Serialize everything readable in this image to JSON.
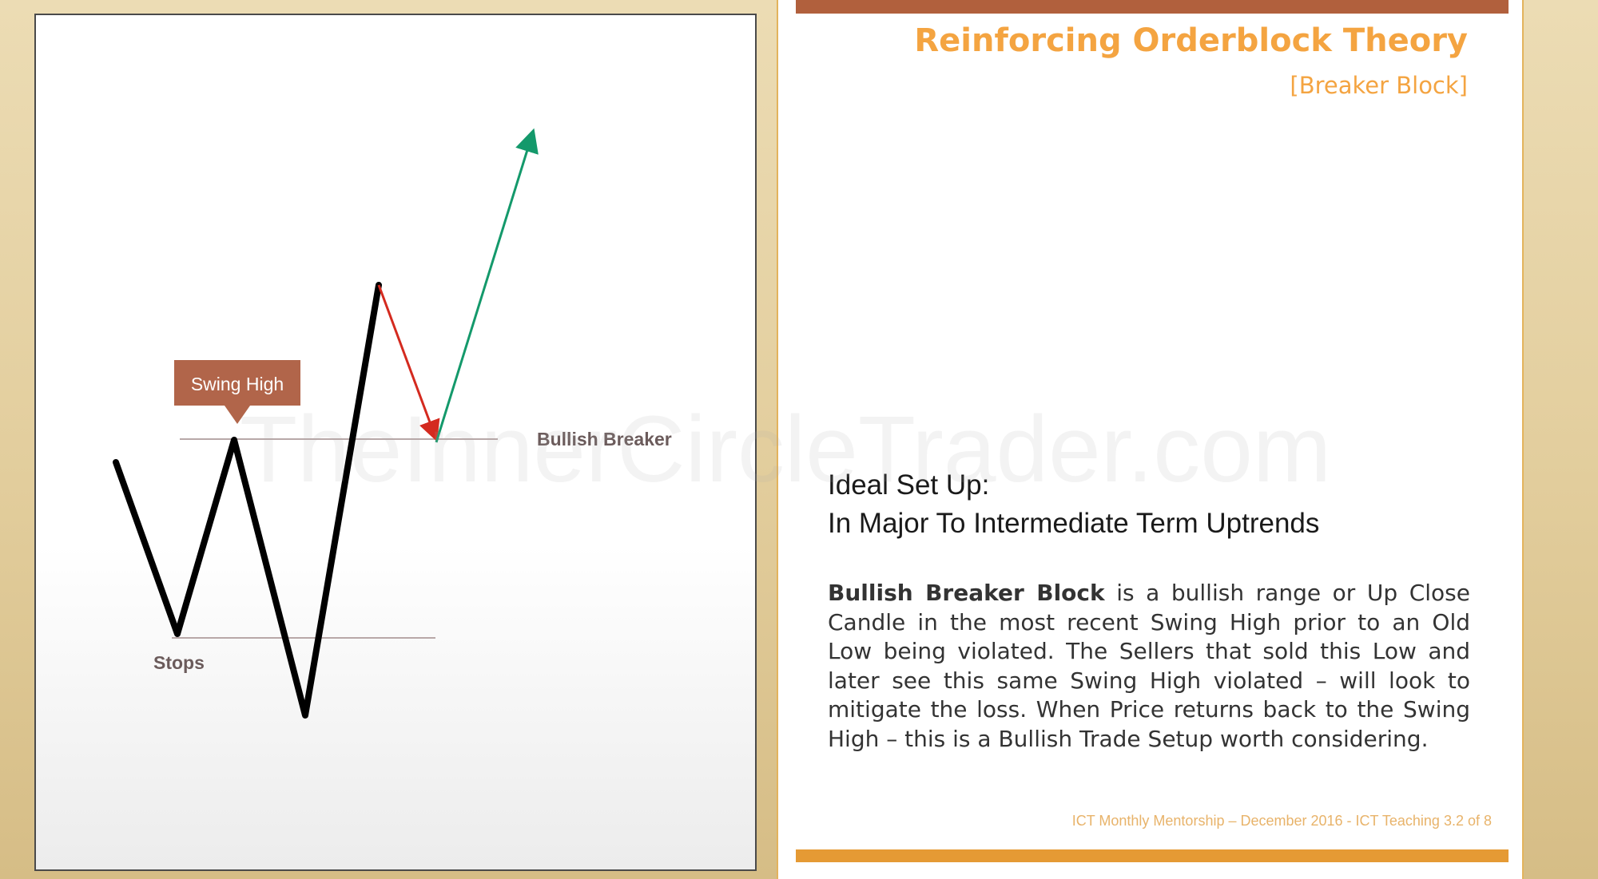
{
  "diagram": {
    "labels": {
      "swing_high": "Swing High",
      "bullish_breaker": "Bullish Breaker",
      "stops": "Stops"
    },
    "colors": {
      "price_path": "#000000",
      "pullback": "#d42a1f",
      "rally": "#14996b",
      "callout": "#b1654a",
      "level_line": "#b8a8a8",
      "label_text": "#6b5b5b"
    }
  },
  "slide": {
    "title": "Reinforcing Orderblock Theory",
    "subtitle": "[Breaker Block]",
    "setup_heading_line1": "Ideal Set Up:",
    "setup_heading_line2": "In Major To Intermediate Term Uptrends",
    "definition_term": "Bullish Breaker Block",
    "definition_text": " is a bullish range or Up Close Candle in the most recent Swing High prior to an Old Low being violated.  The Sellers that sold this Low and later see this same Swing High violated – will look to mitigate the loss.  When Price returns back to the Swing High – this is a Bullish Trade Setup worth considering.",
    "footer": "ICT Monthly Mentorship – December 2016 - ICT Teaching 3.2 of 8",
    "watermark": "TheInnerCircleTrader.com"
  },
  "colors": {
    "accent_orange": "#f4a441",
    "top_bar": "#b1603d",
    "bottom_bar": "#e59a34",
    "background_gold": "#e2cd9c"
  }
}
